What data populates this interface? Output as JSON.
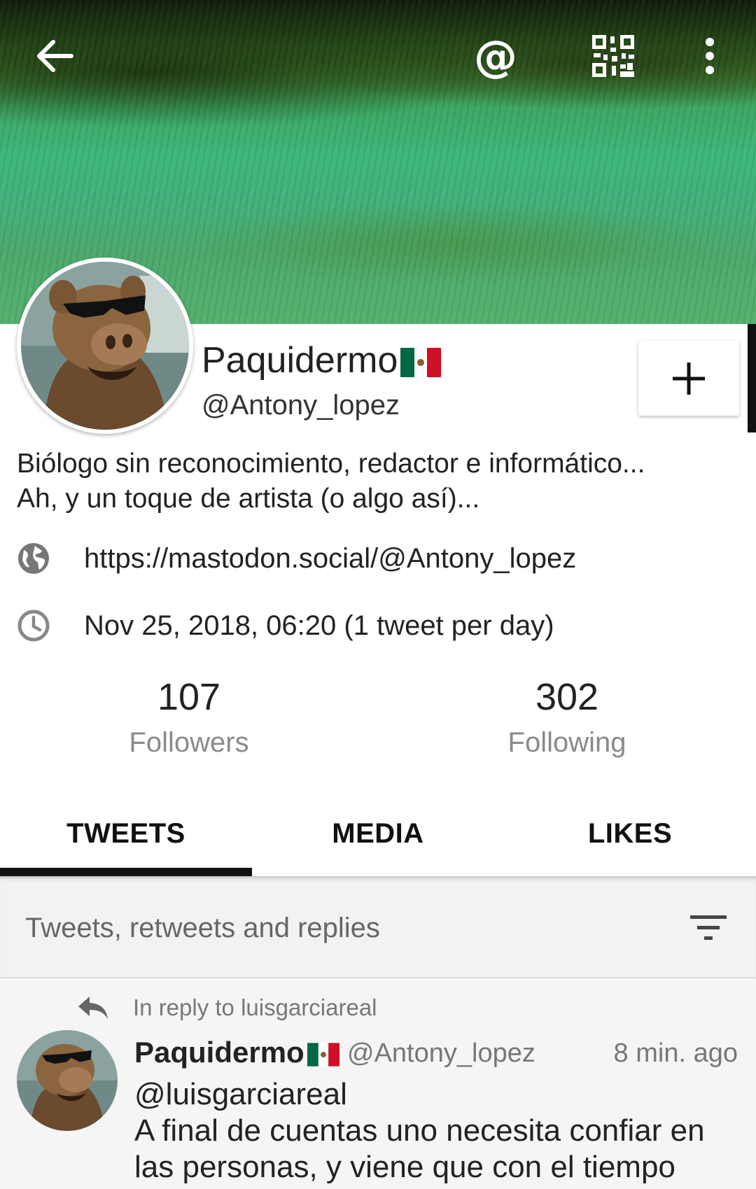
{
  "header": {
    "icons": [
      "back-arrow-icon",
      "mention-icon",
      "qr-code-icon",
      "more-vert-icon"
    ],
    "mention_symbol": "@"
  },
  "profile": {
    "display_name": "Paquidermo",
    "handle": "@Antony_lopez",
    "follow_button_symbol": "+",
    "bio_line1": "Biólogo sin reconocimiento, redactor e informático...",
    "bio_line2": "Ah, y un toque de artista (o algo así)...",
    "website": "https://mastodon.social/@Antony_lopez",
    "joined": "Nov 25, 2018, 06:20 (1 tweet per day)",
    "followers_count": "107",
    "followers_label": "Followers",
    "following_count": "302",
    "following_label": "Following"
  },
  "tabs": [
    {
      "label": "TWEETS",
      "selected": true
    },
    {
      "label": "MEDIA",
      "selected": false
    },
    {
      "label": "LIKES",
      "selected": false
    }
  ],
  "filter": {
    "label": "Tweets, retweets and replies"
  },
  "tweets": [
    {
      "reply_to": "In reply to luisgarciareal",
      "author_name": "Paquidermo",
      "author_handle": "@Antony_lopez",
      "time": "8 min. ago",
      "text_line1": "@luisgarciareal",
      "text_line2": "A final de cuentas uno necesita confiar en",
      "text_line3": "las personas, y viene que con el tiempo"
    }
  ],
  "colors": {
    "accent": "#111111",
    "banner_green": "#3cb57a",
    "muted_text": "#8a8a8a",
    "flag_green": "#006847",
    "flag_red": "#ce1126"
  }
}
